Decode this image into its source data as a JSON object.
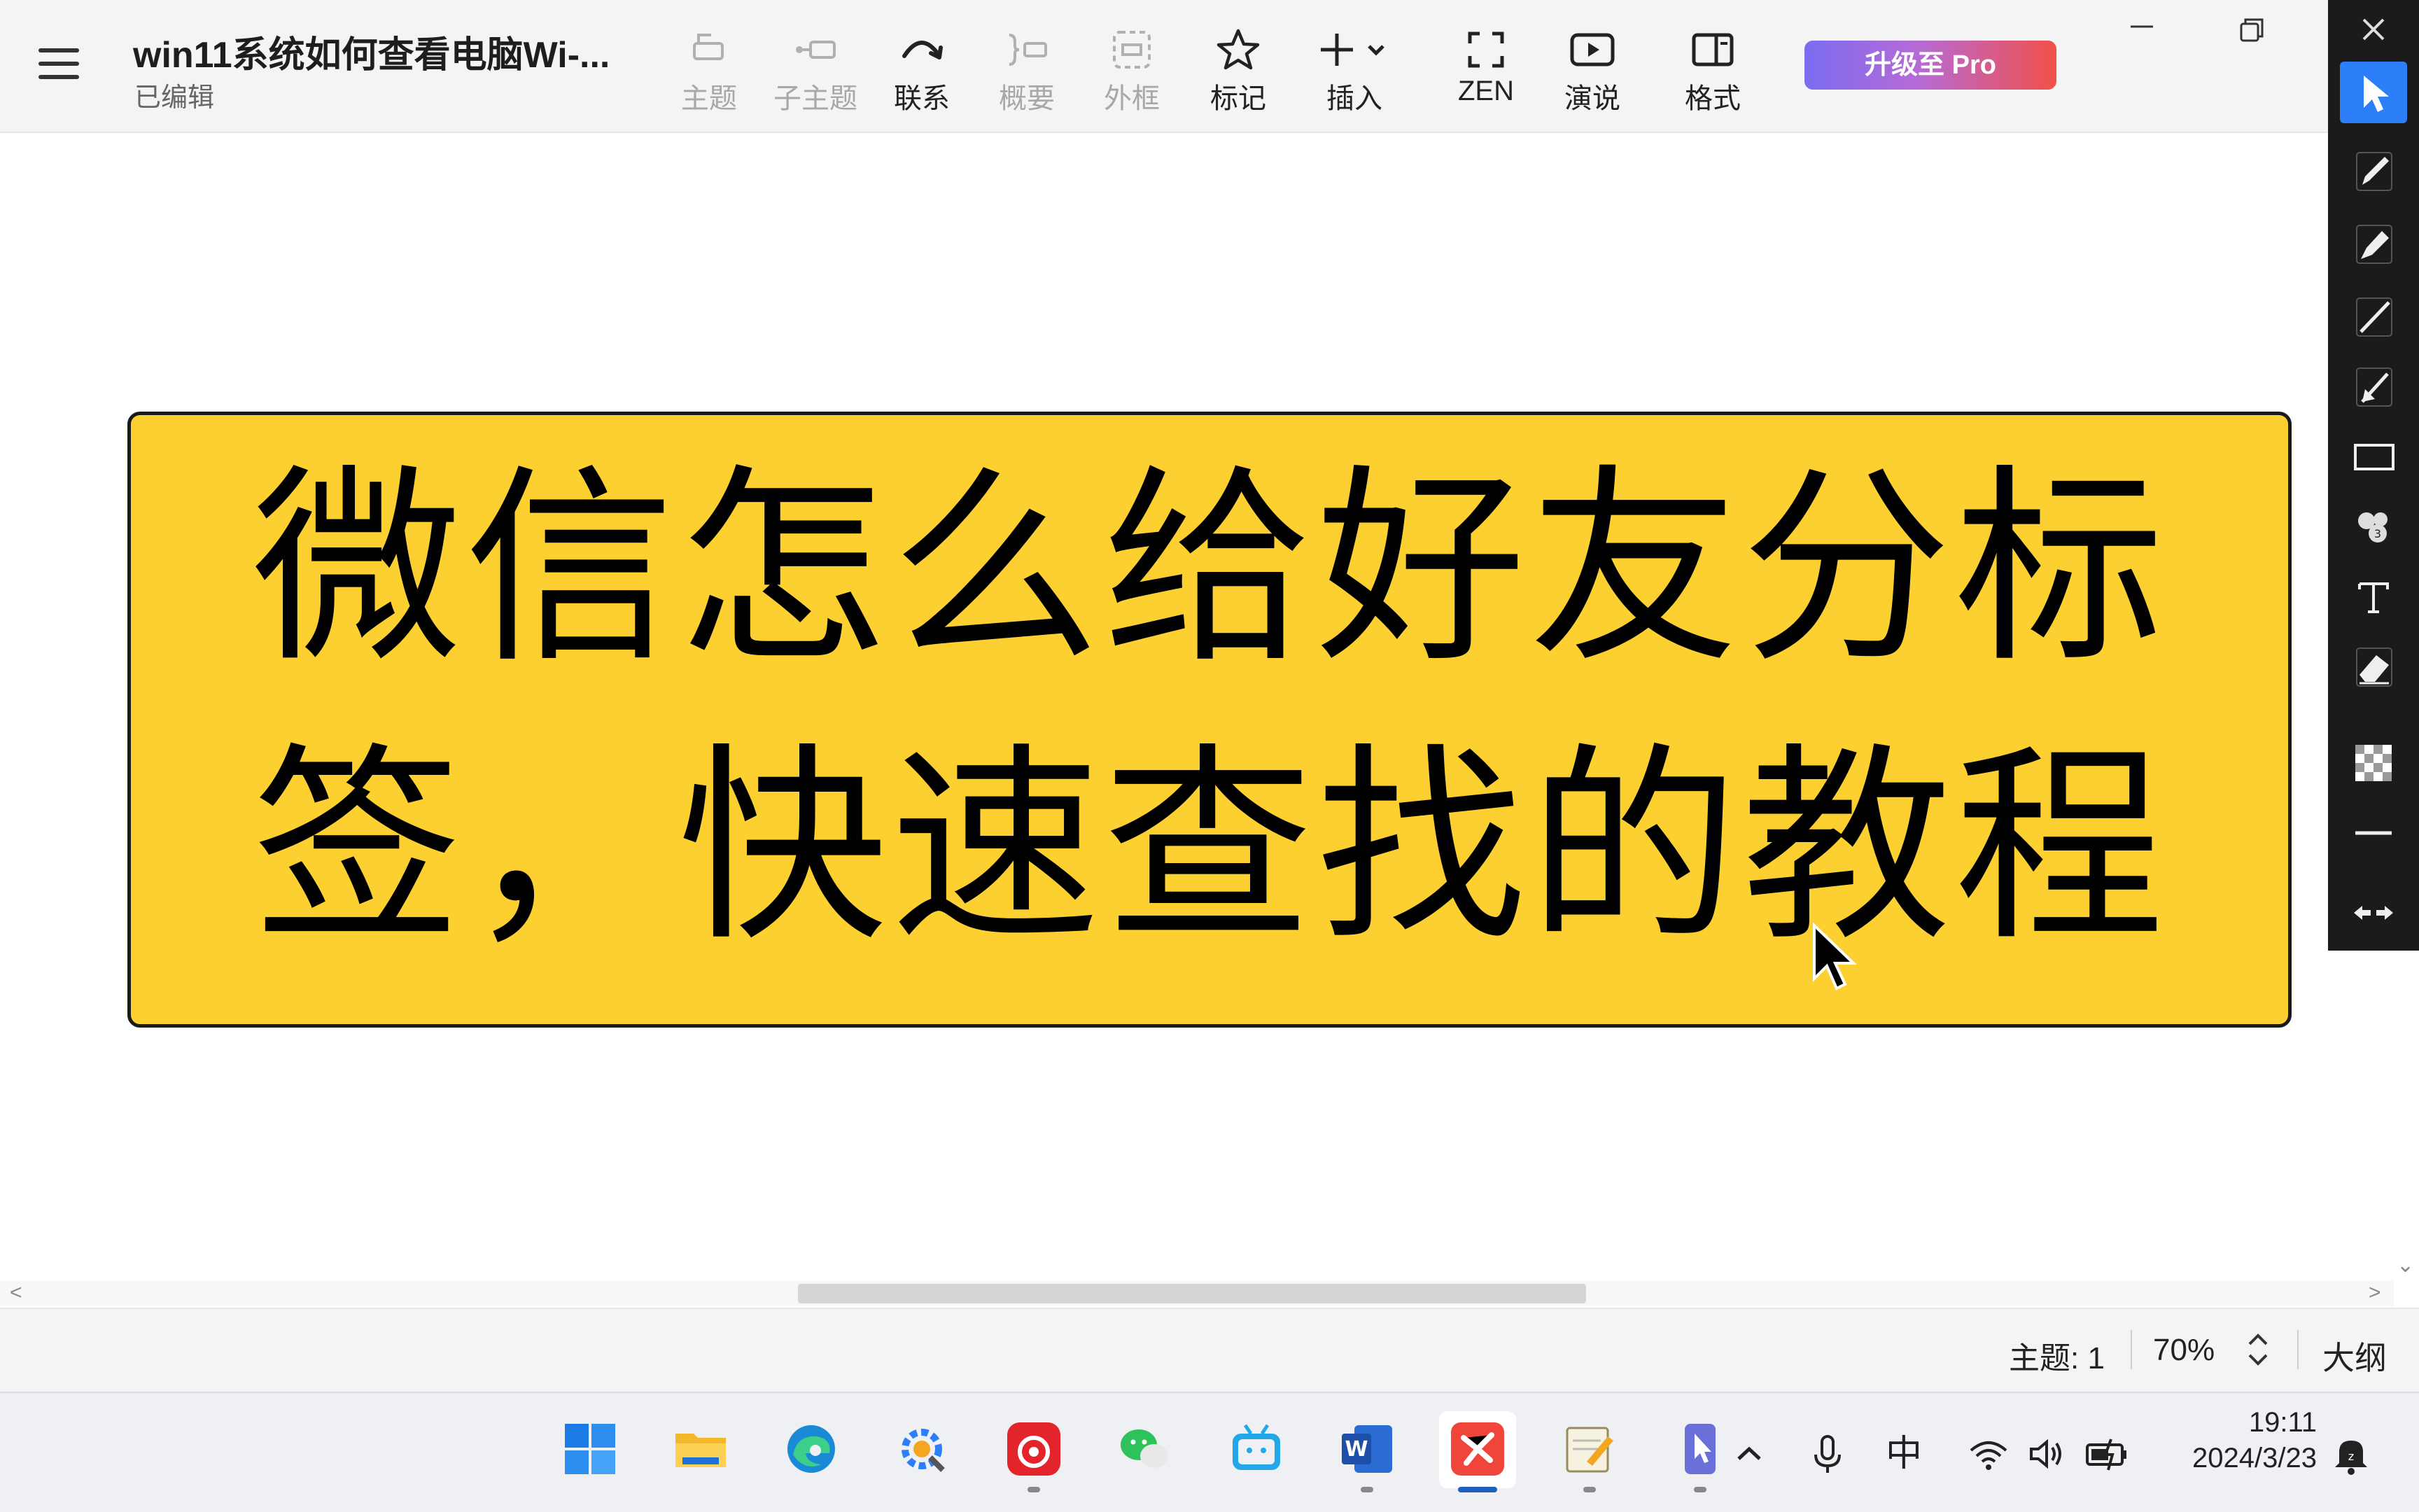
{
  "app": {
    "doc_title": "win11系统如何查看电脑Wi-...",
    "doc_status": "已编辑"
  },
  "toolbar": {
    "tools": [
      {
        "id": "topic",
        "label": "主题",
        "icon": "topic-icon",
        "enabled": false
      },
      {
        "id": "subtopic",
        "label": "子主题",
        "icon": "subtopic-icon",
        "enabled": false
      },
      {
        "id": "relationship",
        "label": "联系",
        "icon": "relationship-icon",
        "enabled": true
      },
      {
        "id": "summary",
        "label": "概要",
        "icon": "summary-icon",
        "enabled": false
      },
      {
        "id": "boundary",
        "label": "外框",
        "icon": "boundary-icon",
        "enabled": false
      },
      {
        "id": "marker",
        "label": "标记",
        "icon": "star-icon",
        "enabled": true
      },
      {
        "id": "insert",
        "label": "插入",
        "icon": "plus-icon",
        "enabled": true
      },
      {
        "id": "zen",
        "label": "ZEN",
        "icon": "fullscreen-icon",
        "enabled": true
      },
      {
        "id": "pitch",
        "label": "演说",
        "icon": "play-icon",
        "enabled": true
      },
      {
        "id": "format",
        "label": "格式",
        "icon": "panel-icon",
        "enabled": true
      }
    ],
    "upgrade_label": "升级至 Pro",
    "colors": {
      "upgrade_start": "#7b6cf2",
      "upgrade_end": "#f2504a"
    }
  },
  "side_panel": {
    "tools": [
      "cursor-icon",
      "pencil-icon",
      "marker-icon",
      "line-icon",
      "arrow-icon",
      "rectangle-icon",
      "stamp-icon",
      "text-icon",
      "eraser-icon",
      "transparency-icon",
      "stroke-width-icon",
      "swap-icon"
    ],
    "active": "cursor-icon",
    "accent": "#2d7ff9"
  },
  "canvas": {
    "topic_line_1": "微信怎么给好友分标",
    "topic_line_2": "签，快速查找的教程",
    "topic_fill": "#fcd030"
  },
  "statusbar": {
    "topic_count": "主题: 1",
    "zoom": "70%",
    "outline_label": "大纲"
  },
  "taskbar": {
    "apps": [
      "windows-start-icon",
      "file-explorer-icon",
      "edge-browser-icon",
      "settings-tool-icon",
      "netease-music-icon",
      "wechat-icon",
      "bilibili-icon",
      "word-icon",
      "xmind-icon",
      "notepad-icon",
      "pen-app-icon"
    ],
    "ime": "中",
    "time": "19:11",
    "date": "2024/3/23"
  }
}
